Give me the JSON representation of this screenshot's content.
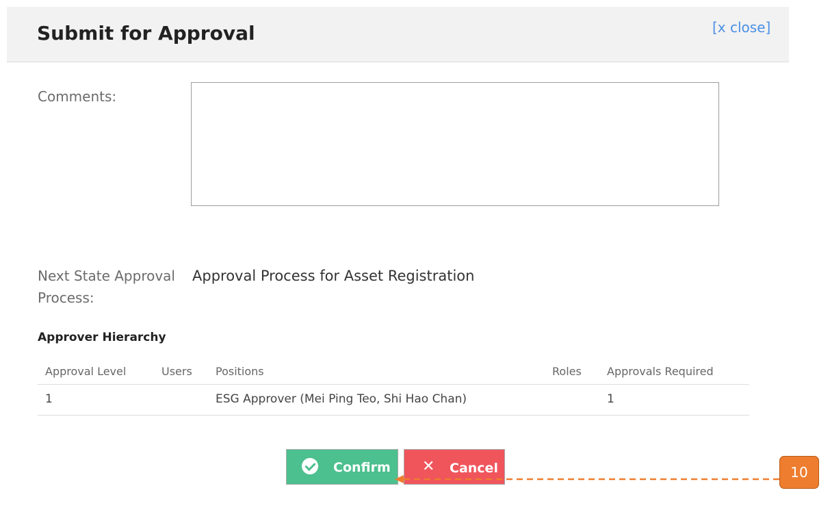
{
  "dialog": {
    "title": "Submit for Approval",
    "close_label": "[x close]"
  },
  "comments": {
    "label": "Comments:",
    "value": ""
  },
  "next_state": {
    "label": "Next State Approval Process:",
    "value": "Approval Process for Asset Registration"
  },
  "approver_hierarchy": {
    "title": "Approver Hierarchy",
    "columns": [
      "Approval Level",
      "Users",
      "Positions",
      "Roles",
      "Approvals Required"
    ],
    "rows": [
      {
        "approval_level": "1",
        "users": "",
        "positions": "ESG Approver (Mei Ping Teo, Shi Hao Chan)",
        "roles": "",
        "approvals_required": "1"
      }
    ]
  },
  "actions": {
    "confirm_label": "Confirm",
    "cancel_label": "Cancel"
  },
  "annotation": {
    "callout_number": "10",
    "color": "#ee7d2f"
  },
  "colors": {
    "confirm": "#4cc08e",
    "cancel": "#f0555c",
    "link": "#4a8fe6"
  },
  "icons": {
    "confirm": "check-circle-icon",
    "cancel": "close-x-icon"
  }
}
